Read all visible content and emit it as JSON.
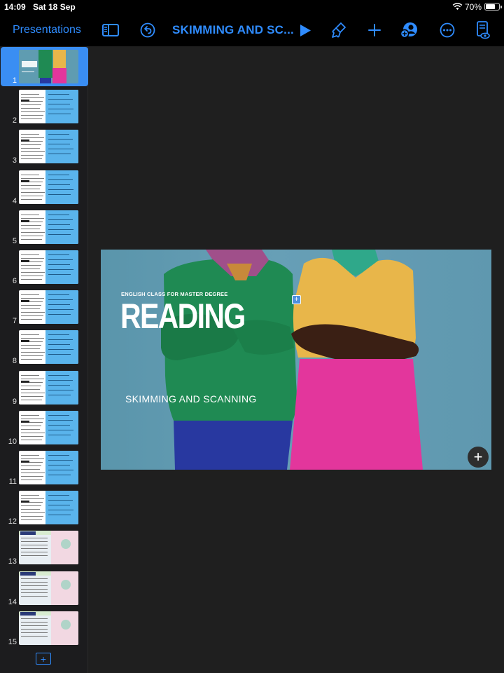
{
  "status_bar": {
    "time": "14:09",
    "date": "Sat 18 Sep",
    "battery_percent": "70%",
    "battery_level": 0.7
  },
  "toolbar": {
    "back_label": "Presentations",
    "document_title": "SKIMMING AND SC...",
    "accent_color": "#2f8cff",
    "icons": [
      "sidebar-icon",
      "undo-icon",
      "play-icon",
      "format-brush-icon",
      "add-icon",
      "collaborate-icon",
      "more-icon",
      "reader-view-icon"
    ]
  },
  "sidebar": {
    "selected_slide": "1",
    "slides": [
      {
        "number": "1",
        "style": "photo"
      },
      {
        "number": "2",
        "style": "split"
      },
      {
        "number": "3",
        "style": "split"
      },
      {
        "number": "4",
        "style": "split"
      },
      {
        "number": "5",
        "style": "split"
      },
      {
        "number": "6",
        "style": "split"
      },
      {
        "number": "7",
        "style": "split"
      },
      {
        "number": "8",
        "style": "split"
      },
      {
        "number": "9",
        "style": "split"
      },
      {
        "number": "10",
        "style": "split"
      },
      {
        "number": "11",
        "style": "split"
      },
      {
        "number": "12",
        "style": "split"
      },
      {
        "number": "13",
        "style": "pastel"
      },
      {
        "number": "14",
        "style": "pastel"
      },
      {
        "number": "15",
        "style": "pastel"
      }
    ]
  },
  "slide": {
    "subtitle": "ENGLISH CLASS FOR MASTER DEGREE",
    "title": "READING",
    "caption": "SKIMMING AND SCANNING"
  }
}
